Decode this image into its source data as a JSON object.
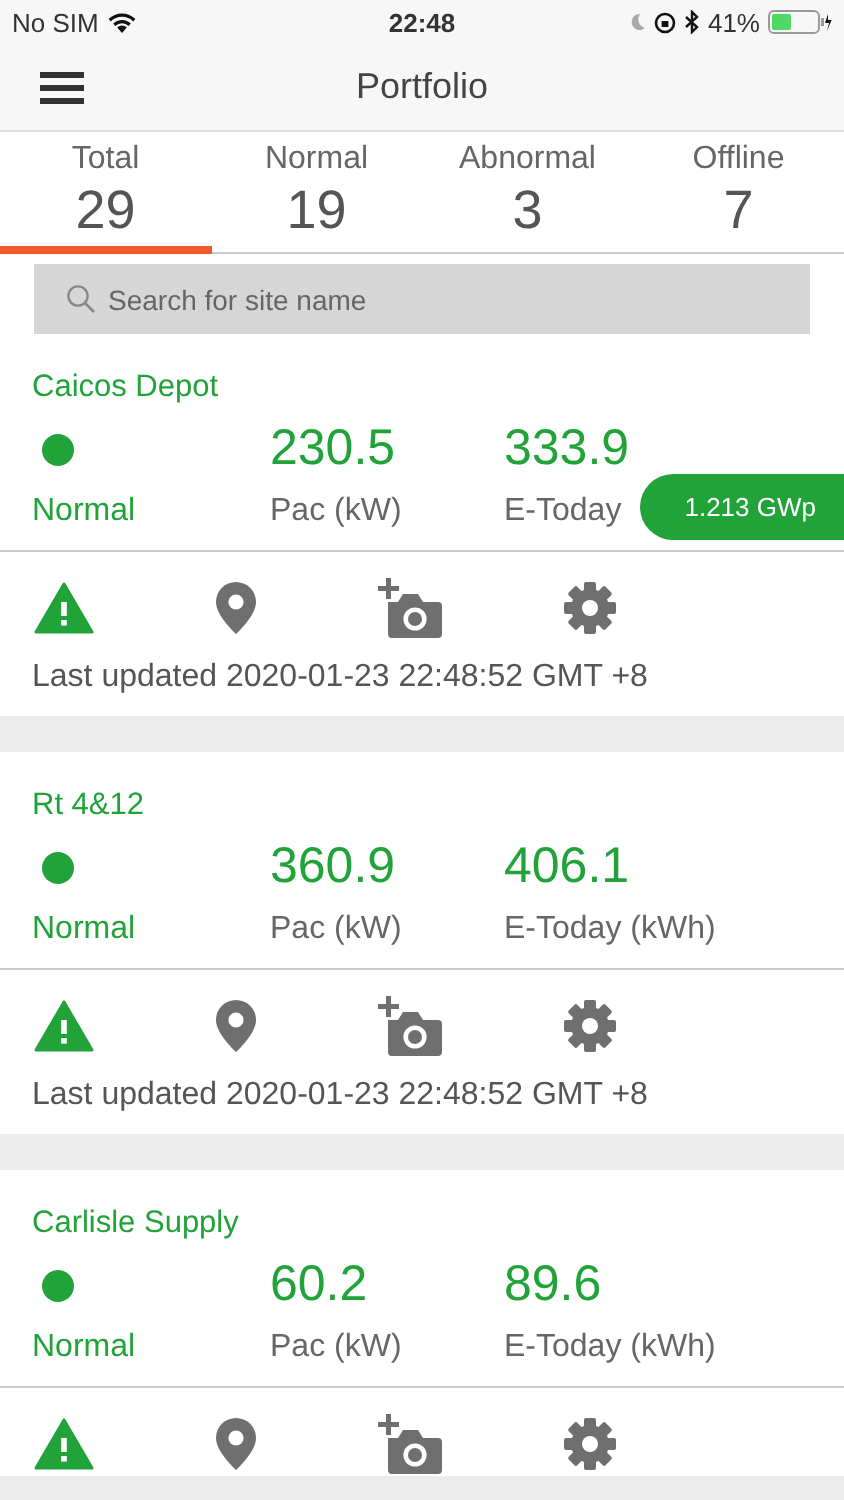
{
  "status_bar": {
    "carrier": "No SIM",
    "time": "22:48",
    "battery": "41%"
  },
  "nav": {
    "title": "Portfolio"
  },
  "tabs": [
    {
      "label": "Total",
      "count": "29",
      "selected": true
    },
    {
      "label": "Normal",
      "count": "19",
      "selected": false
    },
    {
      "label": "Abnormal",
      "count": "3",
      "selected": false
    },
    {
      "label": "Offline",
      "count": "7",
      "selected": false
    }
  ],
  "search": {
    "placeholder": "Search for site name"
  },
  "sites": [
    {
      "name": "Caicos Depot",
      "status": "Normal",
      "pac": "230.5",
      "pac_label": "Pac (kW)",
      "etoday": "333.9",
      "etoday_label": "E-Today",
      "updated": "Last updated 2020-01-23 22:48:52 GMT +8"
    },
    {
      "name": "Rt 4&12",
      "status": "Normal",
      "pac": "360.9",
      "pac_label": "Pac (kW)",
      "etoday": "406.1",
      "etoday_label": "E-Today (kWh)",
      "updated": "Last updated 2020-01-23 22:48:52 GMT +8"
    },
    {
      "name": "Carlisle Supply",
      "status": "Normal",
      "pac": "60.2",
      "pac_label": "Pac (kW)",
      "etoday": "89.6",
      "etoday_label": "E-Today (kWh)"
    }
  ],
  "capacity_badge": "1.213 GWp"
}
